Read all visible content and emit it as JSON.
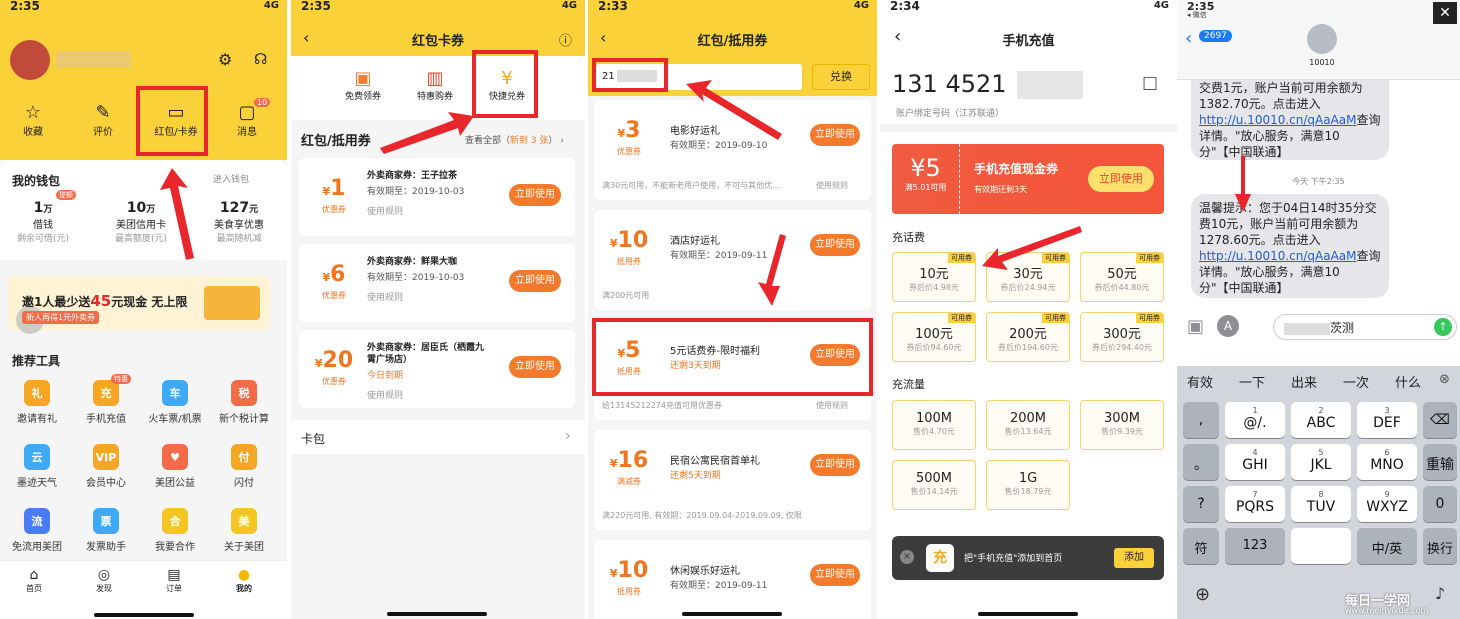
{
  "p1": {
    "status_time": "2:35",
    "status_right": "4G",
    "quick": [
      {
        "label": "收藏",
        "icon": "star-icon"
      },
      {
        "label": "评价",
        "icon": "edit-icon"
      },
      {
        "label": "红包/卡券",
        "icon": "coupon-icon"
      },
      {
        "label": "消息",
        "icon": "message-icon",
        "badge": "10"
      }
    ],
    "wallet_title": "我的钱包",
    "wallet_link": "进入钱包",
    "wallet": [
      {
        "value": "1",
        "unit": "万",
        "name": "借钱",
        "sub": "剩余可借(元)",
        "tag": "提额"
      },
      {
        "value": "10",
        "unit": "万",
        "name": "美团信用卡",
        "sub": "最高额度(元)"
      },
      {
        "value": "127",
        "unit": "元",
        "name": "美食享优惠",
        "sub": "最高随机减"
      }
    ],
    "banner_line1a": "邀1人最少送",
    "banner_amount": "45",
    "banner_line1b": "元现金  无上限",
    "banner_line2": "新人再得1元外卖券",
    "tools_title": "推荐工具",
    "tools": [
      {
        "label": "邀请有礼",
        "glyph": "礼",
        "color": "#f5a623"
      },
      {
        "label": "手机充值",
        "glyph": "充",
        "color": "#f5a623",
        "badge": "特惠"
      },
      {
        "label": "火车票/机票",
        "glyph": "车",
        "color": "#3fa9f5"
      },
      {
        "label": "新个税计算",
        "glyph": "税",
        "color": "#f36c4a"
      },
      {
        "label": "墨迹天气",
        "glyph": "云",
        "color": "#3fa9f5"
      },
      {
        "label": "会员中心",
        "glyph": "VIP",
        "color": "#f5a623"
      },
      {
        "label": "美团公益",
        "glyph": "♥",
        "color": "#f36c4a"
      },
      {
        "label": "闪付",
        "glyph": "付",
        "color": "#f5a623"
      },
      {
        "label": "免流用美团",
        "glyph": "流",
        "color": "#4a7cf5"
      },
      {
        "label": "发票助手",
        "glyph": "票",
        "color": "#3fa9f5"
      },
      {
        "label": "我要合作",
        "glyph": "合",
        "color": "#f5c623"
      },
      {
        "label": "关于美团",
        "glyph": "美",
        "color": "#f5c623"
      }
    ],
    "nav": [
      "首页",
      "发现",
      "订单",
      "我的"
    ]
  },
  "p2": {
    "status_time": "2:35",
    "status_right": "4G",
    "title": "红包卡券",
    "top": [
      {
        "label": "免费领券",
        "icon": "gift-icon"
      },
      {
        "label": "特惠购券",
        "icon": "shop-icon"
      },
      {
        "label": "快捷兑券",
        "icon": "exchange-icon"
      }
    ],
    "section": "红包/抵用券",
    "view_all": "查看全部（",
    "new_count": "新到 3 张",
    "view_all_end": "）",
    "coupons": [
      {
        "amount": "1",
        "type": "优惠券",
        "title": "外卖商家券：王子拉茶",
        "expiry": "有效期至：2019-10-03",
        "rule": "使用规则",
        "btn": "立即使用"
      },
      {
        "amount": "6",
        "type": "优惠券",
        "title": "外卖商家券：鲜果大咖",
        "expiry": "有效期至：2019-10-03",
        "rule": "使用规则",
        "btn": "立即使用"
      },
      {
        "amount": "20",
        "type": "优惠券",
        "title": "外卖商家券：居臣氏（栖霞九",
        "title2": "霄广场店）",
        "expiry": "今日到期",
        "rule": "使用规则",
        "btn": "立即使用"
      }
    ],
    "card_pack": "卡包"
  },
  "p3": {
    "status_time": "2:33",
    "status_right": "4G",
    "title": "红包/抵用券",
    "input_value": "21",
    "exchange_btn": "兑换",
    "coupons": [
      {
        "amount": "3",
        "type": "优惠券",
        "title": "电影好运礼",
        "expiry": "有效期至：2019-09-10",
        "foot": "满30元可用，不能新老用户使用，不可与其他优...",
        "rule": "使用规则",
        "btn": "立即使用"
      },
      {
        "amount": "10",
        "type": "抵用券",
        "title": "酒店好运礼",
        "expiry": "有效期至：2019-09-11",
        "foot": "满200元可用",
        "rule": "",
        "btn": "立即使用"
      },
      {
        "amount": "5",
        "type": "抵用券",
        "title": "5元话费券-限时福利",
        "expiry": "还剩3天到期",
        "foot": "给13145212274充值可用优惠券",
        "rule": "使用规则",
        "btn": "立即使用"
      },
      {
        "amount": "16",
        "type": "满减券",
        "title": "民宿公寓民宿首单礼",
        "expiry": "还剩5天到期",
        "foot": "满220元可用, 有效期：2019.09.04-2019.09.09, 仅限首单",
        "rule": "",
        "btn": "立即使用"
      },
      {
        "amount": "10",
        "type": "抵用券",
        "title": "休闲娱乐好运礼",
        "expiry": "有效期至：2019-09-11",
        "foot": "",
        "rule": "",
        "btn": "立即使用"
      }
    ]
  },
  "p4": {
    "status_time": "2:34",
    "status_right": "4G",
    "title": "手机充值",
    "phone": "131 4521",
    "phone_sub": "账户绑定号码（江苏联通）",
    "coupon_amount": "5",
    "coupon_min": "满5.01可用",
    "coupon_title": "手机充值现金券",
    "coupon_expiry": "有效期还剩3天",
    "coupon_btn": "立即使用",
    "fee_title": "充话费",
    "fees": [
      {
        "v": "10元",
        "sub": "券后价4.98元",
        "tag": "可用券"
      },
      {
        "v": "30元",
        "sub": "券后价24.94元",
        "tag": "可用券"
      },
      {
        "v": "50元",
        "sub": "券后价44.80元",
        "tag": "可用券"
      },
      {
        "v": "100元",
        "sub": "券后价94.60元",
        "tag": "可用券"
      },
      {
        "v": "200元",
        "sub": "券后价194.60元",
        "tag": "可用券"
      },
      {
        "v": "300元",
        "sub": "券后价294.40元",
        "tag": "可用券"
      }
    ],
    "flow_title": "充流量",
    "flows": [
      {
        "v": "100M",
        "sub": "售价4.70元"
      },
      {
        "v": "200M",
        "sub": "售价13.64元"
      },
      {
        "v": "300M",
        "sub": "售价9.39元"
      },
      {
        "v": "500M",
        "sub": "售价14.14元"
      },
      {
        "v": "1G",
        "sub": "售价18.79元"
      }
    ],
    "toast_glyph": "充",
    "toast_text": "把\"手机充值\"添加到首页",
    "toast_btn": "添加"
  },
  "p5": {
    "status_time": "2:35",
    "status_back": "◂ 微信",
    "back_count": "2697",
    "contact": "10010",
    "msg1": "交费1元，账户当前可用余额为1382.70元。点击进入",
    "msg1_link": "http://u.10010.cn/qAaAaM",
    "msg1_end": "查询详情。\"放心服务，满意10分\"【中国联通】",
    "time": "今天 下午2:35",
    "msg2": "温馨提示：您于04日14时35分交费10元，账户当前可用余额为1278.60元。点击进入",
    "msg2_link": "http://u.10010.cn/qAaAaM",
    "msg2_end": "查询详情。\"放心服务，满意10分\"【中国联通】",
    "input_text": "茨测",
    "candidates": [
      "有效",
      "一下",
      "出来",
      "一次",
      "什么"
    ],
    "keys": [
      [
        ",",
        "@/.",
        "ABC",
        "DEF",
        "⌫"
      ],
      [
        "。",
        "GHI",
        "JKL",
        "MNO",
        "重输"
      ],
      [
        "?",
        "PQRS",
        "TUV",
        "WXYZ",
        "0"
      ],
      [
        "!",
        "",
        "",
        "",
        ""
      ]
    ],
    "keys_sub": [
      [
        "",
        "1",
        "2",
        "3",
        ""
      ],
      [
        "",
        "4",
        "5",
        "6",
        ""
      ],
      [
        "",
        "7",
        "8",
        "9",
        ""
      ]
    ],
    "bottom_keys": [
      "符",
      "123",
      "",
      "中/英",
      "换行"
    ],
    "watermark": "每日一学网",
    "watermark2": "www.meiriyixue.com"
  }
}
